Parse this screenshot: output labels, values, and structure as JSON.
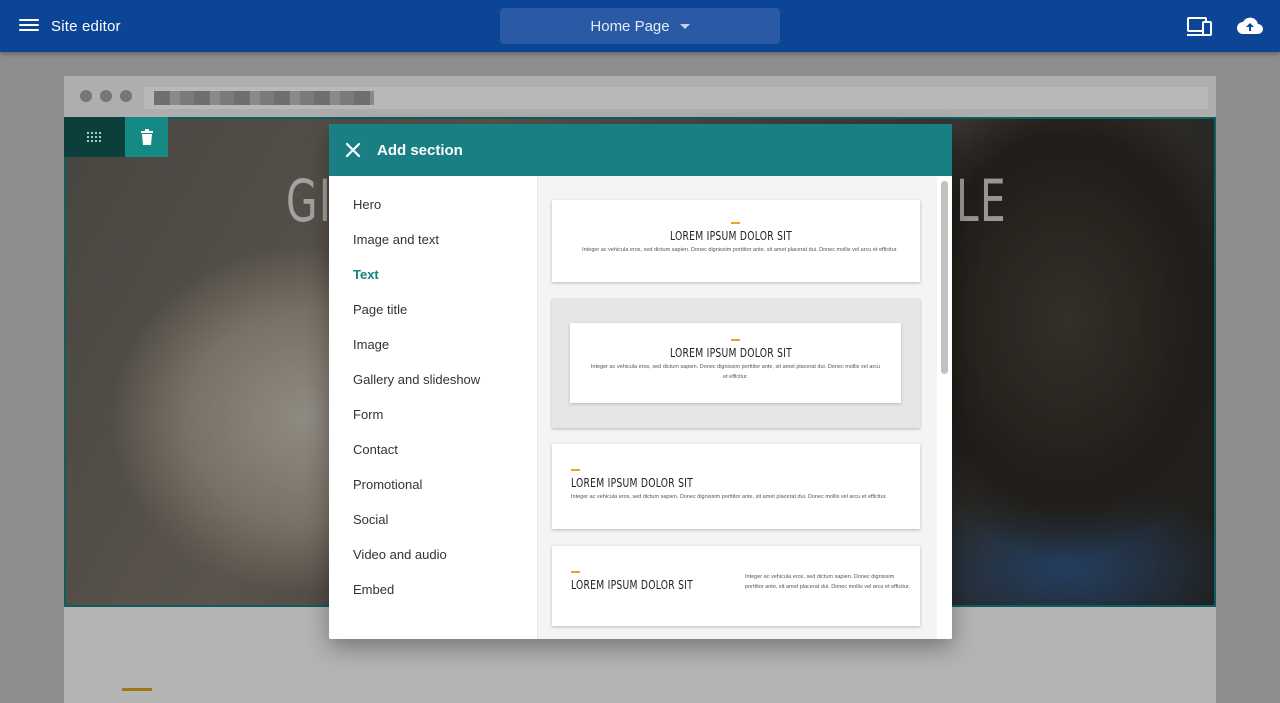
{
  "app_bar": {
    "title": "Site editor",
    "page_selector": "Home Page",
    "icons": [
      "menu-icon",
      "devices-preview-icon",
      "cloud-upload-icon"
    ],
    "color": "#0d4596"
  },
  "background_page": {
    "hero_text_left": "GI",
    "hero_text_right": "LE",
    "section_tools": [
      "drag-grid-icon",
      "delete-icon"
    ],
    "accent_color": "#d4a017"
  },
  "dialog": {
    "title": "Add section",
    "header_color": "#1a7f84",
    "categories": [
      "Hero",
      "Image and text",
      "Text",
      "Page title",
      "Image",
      "Gallery and slideshow",
      "Form",
      "Contact",
      "Promotional",
      "Social",
      "Video and audio",
      "Embed"
    ],
    "selected_category": "Text",
    "previews": [
      {
        "heading": "LOREM IPSUM DOLOR SIT",
        "body": "Integer ac vehicula eros, sed dictum sapien. Donec dignissim porttitor ante, sit amet placerat dui. Donec mollis vel arcu et efficitur."
      },
      {
        "heading": "LOREM IPSUM DOLOR SIT",
        "body": "Integer ac vehicula eros, sed dictum sapien. Donec dignissim porttitor ante, sit amet placerat dui. Donec mollis vel arcu et efficitur."
      },
      {
        "heading": "LOREM IPSUM DOLOR SIT",
        "body": "Integer ac vehicula eros, sed dictum sapien. Donec dignissim porttitor ante, sit amet placerat dui. Donec mollis vel arcu et efficitur."
      },
      {
        "heading": "LOREM IPSUM DOLOR SIT",
        "body": "Integer ac vehicula eros, sed dictum sapien. Donec dignissim porttitor ante, sit amet placerat dui. Donec mollis vel arcu et efficitur."
      }
    ]
  }
}
